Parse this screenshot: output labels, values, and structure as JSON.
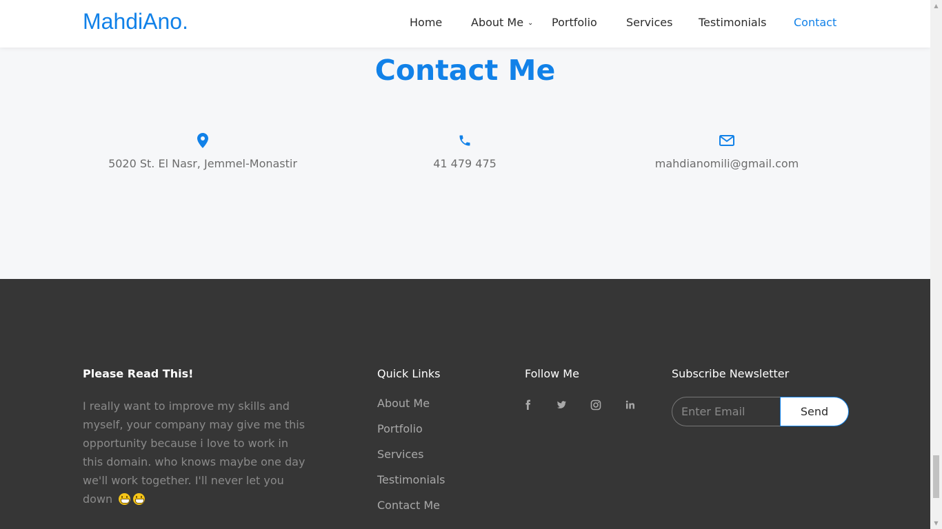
{
  "header": {
    "logo": "MahdiAno.",
    "nav": [
      {
        "label": "Home"
      },
      {
        "label": "About Me"
      },
      {
        "label": "Portfolio"
      },
      {
        "label": "Services"
      },
      {
        "label": "Testimonials"
      },
      {
        "label": "Contact"
      }
    ]
  },
  "contact": {
    "title": "Contact Me",
    "address": "5020 St. El Nasr, Jemmel-Monastir",
    "phone": "41 479 475",
    "email": "mahdianomili@gmail.com"
  },
  "footer": {
    "about": {
      "heading": "Please Read This!",
      "text": "I really want to improve my skills and myself, your company may give me this opportunity because i love to work in this domain. who knows maybe one day we'll work together. I'll never let you down"
    },
    "quick_links": {
      "heading": "Quick Links",
      "items": [
        "About Me",
        "Portfolio",
        "Services",
        "Testimonials",
        "Contact Me"
      ]
    },
    "follow": {
      "heading": "Follow Me",
      "icons": [
        "facebook-icon",
        "twitter-icon",
        "instagram-icon",
        "linkedin-icon"
      ]
    },
    "newsletter": {
      "heading": "Subscribe Newsletter",
      "placeholder": "Enter Email",
      "button": "Send"
    }
  },
  "colors": {
    "accent": "#1181e8",
    "footer_bg": "#363636",
    "section_bg": "#f6f7f9"
  }
}
